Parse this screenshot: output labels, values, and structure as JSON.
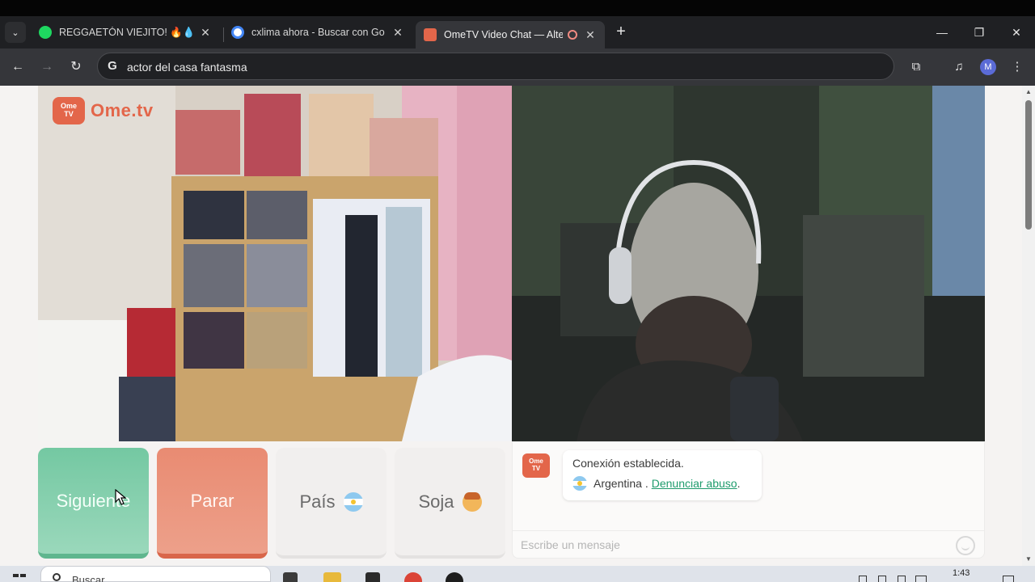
{
  "browser": {
    "tabs": [
      {
        "title": "REGGAETÓN VIEJITO! 🔥💧 - pl",
        "favicon": "spotify-icon",
        "favicon_color": "#1ed760",
        "active": false
      },
      {
        "title": "cxlima ahora - Buscar con Goo",
        "favicon": "google-icon",
        "favicon_color": "#ffffff",
        "active": false
      },
      {
        "title": "OmeTV Video Chat — Alter",
        "favicon": "ometv-icon",
        "favicon_color": "#e3664a",
        "active": true
      }
    ],
    "close_glyph": "✕",
    "new_tab_glyph": "+",
    "address": "actor del casa fantasma",
    "profile_initial": "M"
  },
  "site": {
    "logo_badge": "Ome\nTV",
    "logo_text": "Ome.tv",
    "buttons": {
      "next": "Siguiente",
      "stop": "Parar",
      "country": "País",
      "gender": "Soja"
    },
    "chat": {
      "logo_badge": "Ome\nTV",
      "status": "Conexión establecida.",
      "country": "Argentina .",
      "report": "Denunciar abuso",
      "report_suffix": ".",
      "input_placeholder": "Escribe un mensaje"
    }
  },
  "taskbar": {
    "search_text": "Buscar",
    "time": "1:43"
  },
  "colors": {
    "next_button": "#74c8a2",
    "stop_button": "#e98b72",
    "brand": "#e3664a",
    "link": "#1e9b6c"
  }
}
